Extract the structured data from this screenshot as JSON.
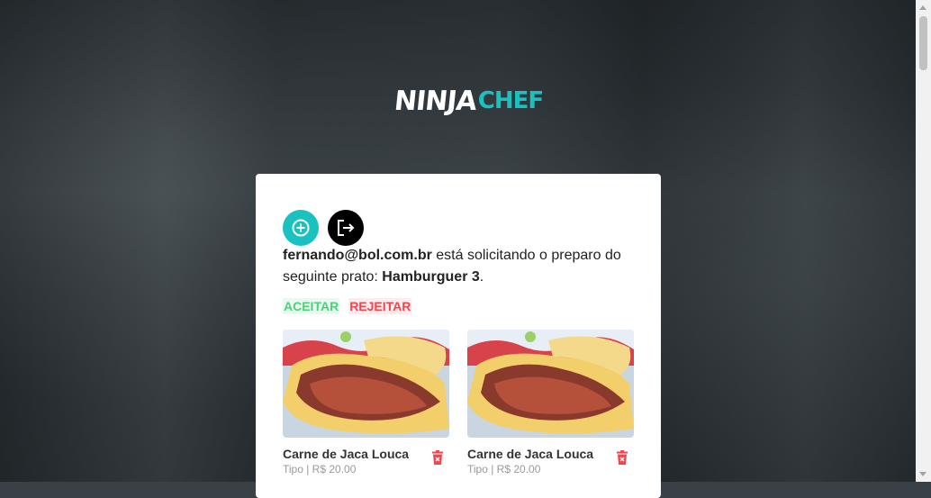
{
  "brand": {
    "logo_part1": "NINJA",
    "logo_part2": "CHEF",
    "accent": "#19c1c1"
  },
  "toolbar": {
    "add_icon": "plus-circle-icon",
    "logout_icon": "logout-icon"
  },
  "request": {
    "email": "fernando@bol.com.br",
    "text_middle": " está solicitando o preparo do seguinte prato: ",
    "dish": "Hamburguer 3",
    "text_end": "."
  },
  "actions": {
    "accept_label": "ACEITAR",
    "reject_label": "REJEITAR",
    "accept_color": "#4cd07a",
    "reject_color": "#f0474e"
  },
  "items": [
    {
      "name": "Carne de Jaca Louca",
      "subtitle": "Tipo | R$ 20.00",
      "icon": "trash-icon"
    },
    {
      "name": "Carne de Jaca Louca",
      "subtitle": "Tipo | R$ 20.00",
      "icon": "trash-icon"
    }
  ]
}
